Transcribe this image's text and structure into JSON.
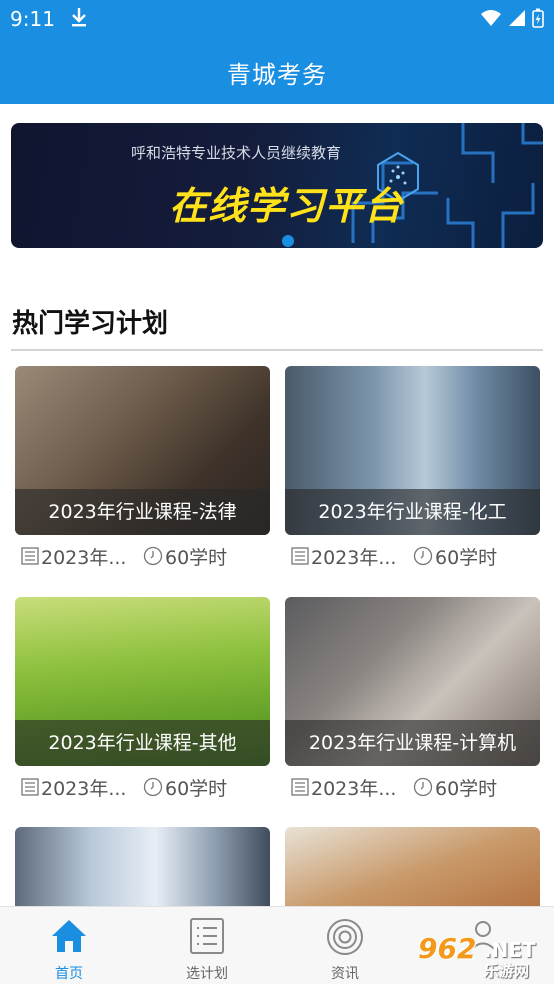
{
  "status": {
    "time": "9:11"
  },
  "app": {
    "title": "青城考务"
  },
  "banner": {
    "subtitle": "呼和浩特专业技术人员继续教育",
    "headline": "在线学习平台"
  },
  "section": {
    "title": "热门学习计划"
  },
  "cards": [
    {
      "caption": "2023年行业课程-法律",
      "date": "2023年...",
      "hours": "60学时"
    },
    {
      "caption": "2023年行业课程-化工",
      "date": "2023年...",
      "hours": "60学时"
    },
    {
      "caption": "2023年行业课程-其他",
      "date": "2023年...",
      "hours": "60学时"
    },
    {
      "caption": "2023年行业课程-计算机",
      "date": "2023年...",
      "hours": "60学时"
    },
    {
      "caption": "",
      "date": "",
      "hours": ""
    },
    {
      "caption": "",
      "date": "",
      "hours": ""
    }
  ],
  "tabs": [
    {
      "label": "首页",
      "icon": "home-icon",
      "active": true
    },
    {
      "label": "选计划",
      "icon": "list-icon",
      "active": false
    },
    {
      "label": "资讯",
      "icon": "news-icon",
      "active": false
    },
    {
      "label": "",
      "icon": "user-icon",
      "active": false
    }
  ],
  "watermark": {
    "num": "962",
    "net": ".NET",
    "cn": "乐游网"
  },
  "colors": {
    "primary": "#1a8ee1",
    "headline": "#ffe21a"
  }
}
